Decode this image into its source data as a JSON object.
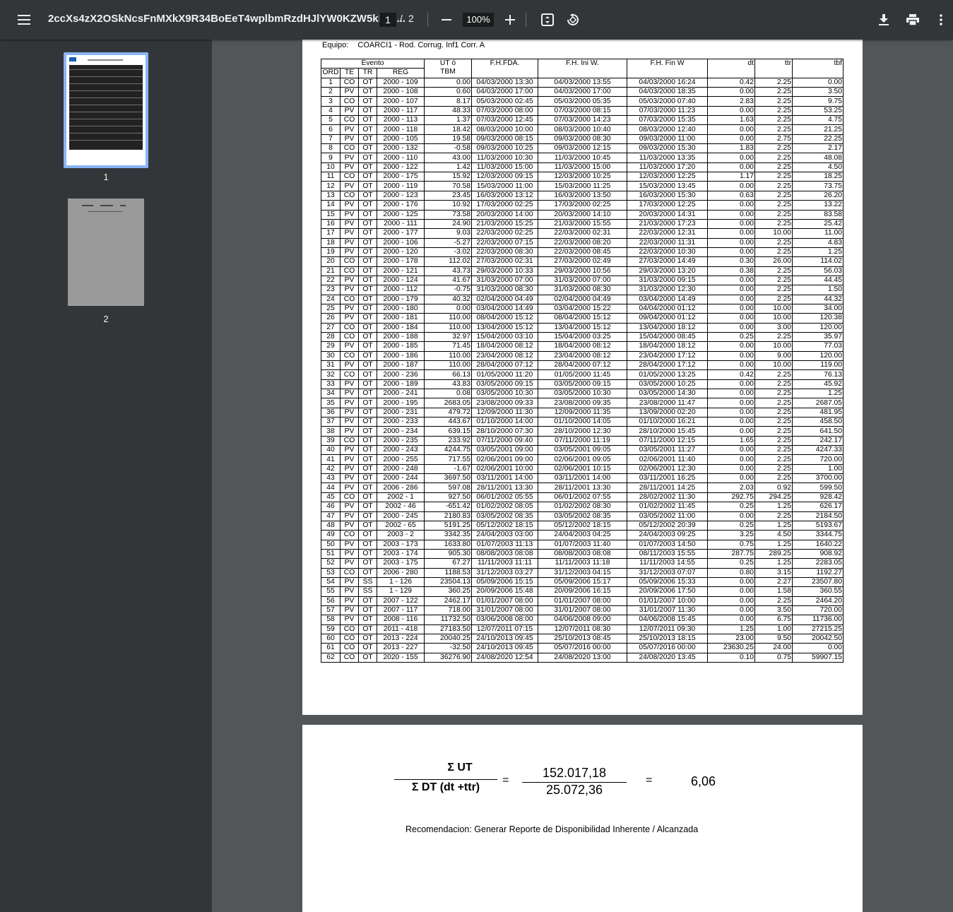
{
  "toolbar": {
    "title": "2ccXs4zX2OSkNcsFnMXkX9R34BoEeT4wplbmRzdHJlYW0KZW5kb2J...",
    "current_page": "1",
    "separator": "/",
    "total_pages": "2",
    "zoom": "100%"
  },
  "sidebar": {
    "thumbs": [
      {
        "label": "1"
      },
      {
        "label": "2"
      }
    ]
  },
  "page1": {
    "equipo_label": "Equipo:",
    "equipo_value": "COARCI1 - Rod. Corrug. Inf1 Corr. A",
    "headers": {
      "evento": "Evento",
      "ord": "ORD",
      "te": "TE",
      "tr": "TR",
      "reg": "REG",
      "ut": "UT ó",
      "tbm": "TBM",
      "fh_fda": "F.H.FDA.",
      "fh_ini": "F.H. Ini W.",
      "fh_fin": "F.H. Fin W",
      "dt": "dt",
      "ttr": "ttr",
      "tbf": "tbf"
    },
    "rows": [
      [
        "1",
        "CO",
        "OT",
        "2000 - 109",
        "0.00",
        "04/03/2000 13:30",
        "04/03/2000 13:55",
        "04/03/2000 16:24",
        "0.42",
        "2.25",
        "0.00"
      ],
      [
        "2",
        "PV",
        "OT",
        "2000 - 108",
        "0.60",
        "04/03/2000 17:00",
        "04/03/2000 17:00",
        "04/03/2000 18:35",
        "0.00",
        "2.25",
        "3.50"
      ],
      [
        "3",
        "CO",
        "OT",
        "2000 - 107",
        "8.17",
        "05/03/2000 02:45",
        "05/03/2000 05:35",
        "05/03/2000 07:40",
        "2.83",
        "2.25",
        "9.75"
      ],
      [
        "4",
        "PV",
        "OT",
        "2000 - 117",
        "48.33",
        "07/03/2000 08:00",
        "07/03/2000 08:15",
        "07/03/2000 11:23",
        "0.00",
        "2.25",
        "53.25"
      ],
      [
        "5",
        "CO",
        "OT",
        "2000 - 113",
        "1.37",
        "07/03/2000 12:45",
        "07/03/2000 14:23",
        "07/03/2000 15:35",
        "1.63",
        "2.25",
        "4.75"
      ],
      [
        "6",
        "PV",
        "OT",
        "2000 - 118",
        "18.42",
        "08/03/2000 10:00",
        "08/03/2000 10:40",
        "08/03/2000 12:40",
        "0.00",
        "2.25",
        "21.25"
      ],
      [
        "7",
        "PV",
        "OT",
        "2000 - 105",
        "19.58",
        "09/03/2000 08:15",
        "09/03/2000 08:30",
        "09/03/2000 11:00",
        "0.00",
        "2.75",
        "22.25"
      ],
      [
        "8",
        "CO",
        "OT",
        "2000 - 132",
        "-0.58",
        "09/03/2000 10:25",
        "09/03/2000 12:15",
        "09/03/2000 15:30",
        "1.83",
        "2.25",
        "2.17"
      ],
      [
        "9",
        "PV",
        "OT",
        "2000 - 110",
        "43.00",
        "11/03/2000 10:30",
        "11/03/2000 10:45",
        "11/03/2000 13:35",
        "0.00",
        "2.25",
        "48.08"
      ],
      [
        "10",
        "PV",
        "OT",
        "2000 - 122",
        "1.42",
        "11/03/2000 15:00",
        "11/03/2000 15:00",
        "11/03/2000 17:20",
        "0.00",
        "2.25",
        "4.50"
      ],
      [
        "11",
        "CO",
        "OT",
        "2000 - 175",
        "15.92",
        "12/03/2000 09:15",
        "12/03/2000 10:25",
        "12/03/2000 12:25",
        "1.17",
        "2.25",
        "18.25"
      ],
      [
        "12",
        "PV",
        "OT",
        "2000 - 119",
        "70.58",
        "15/03/2000 11:00",
        "15/03/2000 11:25",
        "15/03/2000 13:45",
        "0.00",
        "2.25",
        "73.75"
      ],
      [
        "13",
        "CO",
        "OT",
        "2000 - 123",
        "23.45",
        "16/03/2000 13:12",
        "16/03/2000 13:50",
        "16/03/2000 15:30",
        "0.63",
        "2.25",
        "26.20"
      ],
      [
        "14",
        "PV",
        "OT",
        "2000 - 176",
        "10.92",
        "17/03/2000 02:25",
        "17/03/2000 02:25",
        "17/03/2000 12:25",
        "0.00",
        "2.25",
        "13.22"
      ],
      [
        "15",
        "PV",
        "OT",
        "2000 - 125",
        "73.58",
        "20/03/2000 14:00",
        "20/03/2000 14:10",
        "20/03/2000 14:31",
        "0.00",
        "2.25",
        "83.58"
      ],
      [
        "16",
        "PV",
        "OT",
        "2000 - 111",
        "24.90",
        "21/03/2000 15:25",
        "21/03/2000 15:55",
        "21/03/2000 17:23",
        "0.00",
        "2.25",
        "25.42"
      ],
      [
        "17",
        "PV",
        "OT",
        "2000 - 177",
        "9.03",
        "22/03/2000 02:25",
        "22/03/2000 02:31",
        "22/03/2000 12:31",
        "0.00",
        "10.00",
        "11.00"
      ],
      [
        "18",
        "PV",
        "OT",
        "2000 - 106",
        "-5.27",
        "22/03/2000 07:15",
        "22/03/2000 08:20",
        "22/03/2000 11:31",
        "0.00",
        "2.25",
        "4.83"
      ],
      [
        "19",
        "PV",
        "OT",
        "2000 - 120",
        "-3.02",
        "22/03/2000 08:30",
        "22/03/2000 08:45",
        "22/03/2000 10:30",
        "0.00",
        "2.25",
        "1.25"
      ],
      [
        "20",
        "CO",
        "OT",
        "2000 - 178",
        "112.02",
        "27/03/2000 02:31",
        "27/03/2000 02:49",
        "27/03/2000 14:49",
        "0.30",
        "26.00",
        "114.02"
      ],
      [
        "21",
        "CO",
        "OT",
        "2000 - 121",
        "43.73",
        "29/03/2000 10:33",
        "29/03/2000 10:56",
        "29/03/2000 13:20",
        "0.38",
        "2.25",
        "56.03"
      ],
      [
        "22",
        "PV",
        "OT",
        "2000 - 124",
        "41.67",
        "31/03/2000 07:00",
        "31/03/2000 07:00",
        "31/03/2000 09:15",
        "0.00",
        "2.25",
        "44.45"
      ],
      [
        "23",
        "PV",
        "OT",
        "2000 - 112",
        "-0.75",
        "31/03/2000 08:30",
        "31/03/2000 08:30",
        "31/03/2000 12:30",
        "0.00",
        "2.25",
        "1.50"
      ],
      [
        "24",
        "CO",
        "OT",
        "2000 - 179",
        "40.32",
        "02/04/2000 04:49",
        "02/04/2000 04:49",
        "03/04/2000 14:49",
        "0.00",
        "2.25",
        "44.32"
      ],
      [
        "25",
        "PV",
        "OT",
        "2000 - 180",
        "0.00",
        "03/04/2000 14:49",
        "03/04/2000 15:22",
        "04/04/2000 01:12",
        "0.00",
        "10.00",
        "34.00"
      ],
      [
        "26",
        "PV",
        "OT",
        "2000 - 181",
        "110.00",
        "08/04/2000 15:12",
        "08/04/2000 15:12",
        "09/04/2000 01:12",
        "0.00",
        "10.00",
        "120.38"
      ],
      [
        "27",
        "CO",
        "OT",
        "2000 - 184",
        "110.00",
        "13/04/2000 15:12",
        "13/04/2000 15:12",
        "13/04/2000 18:12",
        "0.00",
        "3.00",
        "120.00"
      ],
      [
        "28",
        "CO",
        "OT",
        "2000 - 188",
        "32.97",
        "15/04/2000 03:10",
        "15/04/2000 03:25",
        "15/04/2000 08:45",
        "0.25",
        "2.25",
        "35.97"
      ],
      [
        "29",
        "PV",
        "OT",
        "2000 - 185",
        "71.45",
        "18/04/2000 08:12",
        "18/04/2000 08:12",
        "18/04/2000 18:12",
        "0.00",
        "10.00",
        "77.03"
      ],
      [
        "30",
        "CO",
        "OT",
        "2000 - 186",
        "110.00",
        "23/04/2000 08:12",
        "23/04/2000 08:12",
        "23/04/2000 17:12",
        "0.00",
        "9.00",
        "120.00"
      ],
      [
        "31",
        "PV",
        "OT",
        "2000 - 187",
        "110.00",
        "28/04/2000 07:12",
        "28/04/2000 07:12",
        "28/04/2000 17:12",
        "0.00",
        "10.00",
        "119.00"
      ],
      [
        "32",
        "CO",
        "OT",
        "2000 - 236",
        "66.13",
        "01/05/2000 11:20",
        "01/05/2000 11:45",
        "01/05/2000 13:25",
        "0.42",
        "2.25",
        "76.13"
      ],
      [
        "33",
        "PV",
        "OT",
        "2000 - 189",
        "43.83",
        "03/05/2000 09:15",
        "03/05/2000 09:15",
        "03/05/2000 10:25",
        "0.00",
        "2.25",
        "45.92"
      ],
      [
        "34",
        "PV",
        "OT",
        "2000 - 241",
        "0.08",
        "03/05/2000 10:30",
        "03/05/2000 10:30",
        "03/05/2000 14:30",
        "0.00",
        "2.25",
        "1.25"
      ],
      [
        "35",
        "PV",
        "OT",
        "2000 - 195",
        "2683.05",
        "23/08/2000 09:33",
        "23/08/2000 09:35",
        "23/08/2000 11:47",
        "0.00",
        "2.25",
        "2687.05"
      ],
      [
        "36",
        "PV",
        "OT",
        "2000 - 231",
        "479.72",
        "12/09/2000 11:30",
        "12/09/2000 11:35",
        "13/09/2000 02:20",
        "0.00",
        "2.25",
        "481.95"
      ],
      [
        "37",
        "PV",
        "OT",
        "2000 - 233",
        "443.67",
        "01/10/2000 14:00",
        "01/10/2000 14:05",
        "01/10/2000 16:21",
        "0.00",
        "2.25",
        "458.50"
      ],
      [
        "38",
        "PV",
        "OT",
        "2000 - 234",
        "639.15",
        "28/10/2000 07:30",
        "28/10/2000 12:30",
        "28/10/2000 15:45",
        "0.00",
        "2.25",
        "641.50"
      ],
      [
        "39",
        "CO",
        "OT",
        "2000 - 235",
        "233.92",
        "07/11/2000 09:40",
        "07/11/2000 11:19",
        "07/11/2000 12:15",
        "1.65",
        "2.25",
        "242.17"
      ],
      [
        "40",
        "PV",
        "OT",
        "2000 - 243",
        "4244.75",
        "03/05/2001 09:00",
        "03/05/2001 09:05",
        "03/05/2001 11:27",
        "0.00",
        "2.25",
        "4247.33"
      ],
      [
        "41",
        "PV",
        "OT",
        "2000 - 255",
        "717.55",
        "02/06/2001 09:00",
        "02/06/2001 09:05",
        "02/06/2001 11:40",
        "0.00",
        "2.25",
        "720.00"
      ],
      [
        "42",
        "PV",
        "OT",
        "2000 - 248",
        "-1.67",
        "02/06/2001 10:00",
        "02/06/2001 10:15",
        "02/06/2001 12:30",
        "0.00",
        "2.25",
        "1.00"
      ],
      [
        "43",
        "PV",
        "OT",
        "2000 - 244",
        "3697.50",
        "03/11/2001 14:00",
        "03/11/2001 14:00",
        "03/11/2001 16:25",
        "0.00",
        "2.25",
        "3700.00"
      ],
      [
        "44",
        "PV",
        "OT",
        "2006 - 286",
        "597.08",
        "28/11/2001 13:30",
        "28/11/2001 13:30",
        "28/11/2001 14:25",
        "2.03",
        "0.92",
        "599.50"
      ],
      [
        "45",
        "CO",
        "OT",
        "2002 - 1",
        "927.50",
        "06/01/2002 05:55",
        "06/01/2002 07:55",
        "28/02/2002 11:30",
        "292.75",
        "294.25",
        "928.42"
      ],
      [
        "46",
        "PV",
        "OT",
        "2002 - 46",
        "-651.42",
        "01/02/2002 08:05",
        "01/02/2002 08:30",
        "01/02/2002 11:45",
        "0.25",
        "1.25",
        "626.17"
      ],
      [
        "47",
        "PV",
        "OT",
        "2000 - 245",
        "2180.83",
        "03/05/2002 08:35",
        "03/05/2002 08:35",
        "03/05/2002 11:00",
        "0.00",
        "2.25",
        "2184.50"
      ],
      [
        "48",
        "PV",
        "OT",
        "2002 - 65",
        "5191.25",
        "05/12/2002 18:15",
        "05/12/2002 18:15",
        "05/12/2002 20:39",
        "0.25",
        "1.25",
        "5193.67"
      ],
      [
        "49",
        "CO",
        "OT",
        "2003 - 2",
        "3342.35",
        "24/04/2003 03:00",
        "24/04/2003 04:25",
        "24/04/2003 09:25",
        "3.25",
        "4.50",
        "3344.75"
      ],
      [
        "50",
        "PV",
        "OT",
        "2003 - 173",
        "1633.80",
        "01/07/2003 11:13",
        "01/07/2003 11:40",
        "01/07/2003 14:50",
        "0.75",
        "1.25",
        "1640.22"
      ],
      [
        "51",
        "PV",
        "OT",
        "2003 - 174",
        "905.30",
        "08/08/2003 08:08",
        "08/08/2003 08:08",
        "08/11/2003 15:55",
        "287.75",
        "289.25",
        "908.92"
      ],
      [
        "52",
        "PV",
        "OT",
        "2003 - 175",
        "67.27",
        "11/11/2003 11:11",
        "11/11/2003 11:18",
        "11/11/2003 14:55",
        "0.25",
        "1.25",
        "2283.05"
      ],
      [
        "53",
        "CO",
        "OT",
        "2006 - 280",
        "1188.53",
        "31/12/2003 03:27",
        "31/12/2003 04:15",
        "31/12/2003 07:07",
        "0.80",
        "3.15",
        "1192.27"
      ],
      [
        "54",
        "PV",
        "SS",
        "1 - 126",
        "23504.13",
        "05/09/2006 15:15",
        "05/09/2006 15:17",
        "05/09/2006 15:33",
        "0.00",
        "2.27",
        "23507.80"
      ],
      [
        "55",
        "PV",
        "SS",
        "1 - 129",
        "360.25",
        "20/09/2006 15:48",
        "20/09/2006 16:15",
        "20/09/2006 17:50",
        "0.00",
        "1.58",
        "360.55"
      ],
      [
        "56",
        "PV",
        "OT",
        "2007 - 122",
        "2462.17",
        "01/01/2007 08:00",
        "01/01/2007 08:00",
        "01/01/2007 10:00",
        "0.00",
        "2.25",
        "2464.20"
      ],
      [
        "57",
        "PV",
        "OT",
        "2007 - 117",
        "718.00",
        "31/01/2007 08:00",
        "31/01/2007 08:00",
        "31/01/2007 11:30",
        "0.00",
        "3.50",
        "720.00"
      ],
      [
        "58",
        "PV",
        "OT",
        "2008 - 116",
        "11732.50",
        "03/06/2008 08:00",
        "04/06/2008 09:00",
        "04/06/2008 15:45",
        "0.00",
        "6.75",
        "11736.00"
      ],
      [
        "59",
        "CO",
        "OT",
        "2011 - 418",
        "27183.50",
        "12/07/2011 07:15",
        "12/07/2011 08:30",
        "12/07/2011 09:30",
        "1.25",
        "1.00",
        "27215.25"
      ],
      [
        "60",
        "CO",
        "OT",
        "2013 - 224",
        "20040.25",
        "24/10/2013 09:45",
        "25/10/2013 08:45",
        "25/10/2013 18:15",
        "23.00",
        "9.50",
        "20042.50"
      ],
      [
        "61",
        "CO",
        "OT",
        "2013 - 227",
        "-32.50",
        "24/10/2013 09:45",
        "05/07/2016 00:00",
        "05/07/2016 00:00",
        "23630.25",
        "24.00",
        "0.00"
      ],
      [
        "62",
        "CO",
        "OT",
        "2020 - 155",
        "36276.90",
        "24/08/2020 12:54",
        "24/08/2020 13:00",
        "24/08/2020 13:45",
        "0.10",
        "0.75",
        "59907.15"
      ]
    ]
  },
  "page2": {
    "num_symbolic": "Σ UT",
    "den_symbolic": "Σ DT (dt +ttr)",
    "eq1": "=",
    "num_value": "152.017,18",
    "den_value": "25.072,36",
    "eq2": "=",
    "result": "6,06",
    "recommendation": "Recomendacion: Generar Reporte de Disponibilidad Inherente / Alcanzada"
  }
}
